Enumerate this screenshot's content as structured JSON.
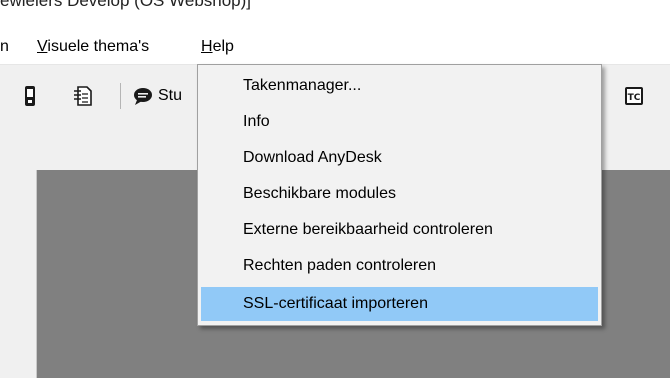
{
  "window": {
    "title": "ewielers Develop (OS Webshop)]"
  },
  "menubar": {
    "items": [
      {
        "label": "n",
        "mnemonic_underline": false
      },
      {
        "label": "Visuele thema's"
      },
      {
        "label": "Help"
      }
    ]
  },
  "toolbar": {
    "buttons": [
      {
        "icon": "device-icon"
      },
      {
        "icon": "document-icon"
      },
      {
        "icon": "speech-bubble-icon",
        "label": "Stu"
      },
      {
        "icon": "tc-icon"
      }
    ]
  },
  "help_menu": {
    "items": [
      {
        "label": "Takenmanager..."
      },
      {
        "label": "Info"
      },
      {
        "label": "Download AnyDesk"
      },
      {
        "label": "Beschikbare modules"
      },
      {
        "label": "Externe bereikbaarheid controleren"
      },
      {
        "label": "Rechten paden controleren"
      },
      {
        "label": "SSL-certificaat importeren",
        "highlighted": true
      }
    ]
  },
  "colors": {
    "highlight": "#91c9f7",
    "workspace": "#808080"
  }
}
